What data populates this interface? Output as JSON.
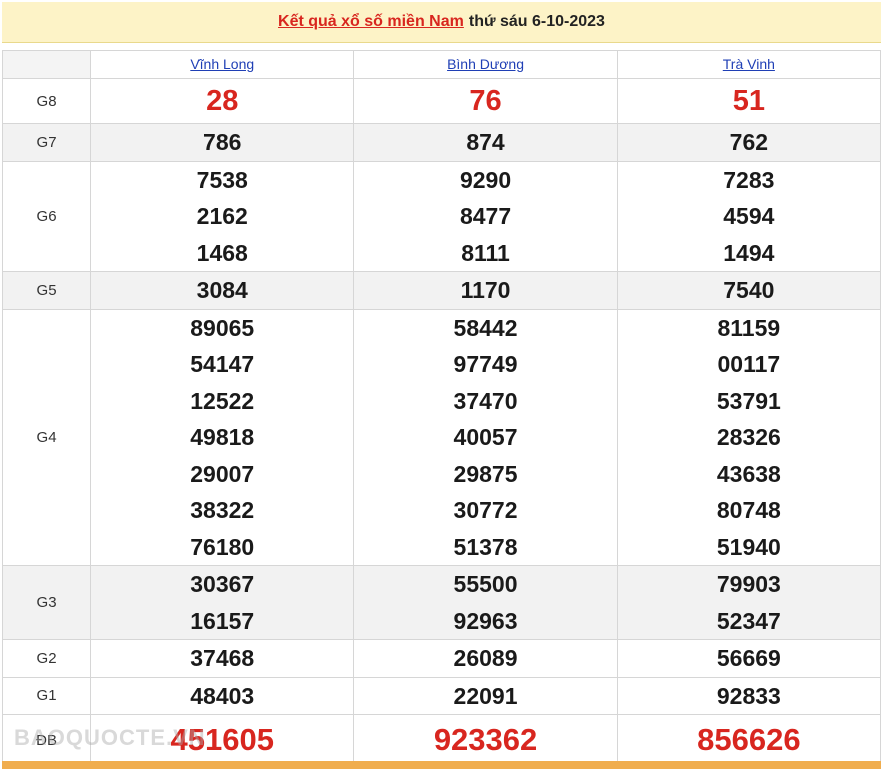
{
  "header": {
    "link_text": "Kết quả xổ số miền Nam",
    "date_text": "thứ sáu 6-10-2023"
  },
  "provinces": [
    "Vĩnh Long",
    "Bình Dương",
    "Trà Vinh"
  ],
  "prizes": [
    {
      "label": "G8",
      "values": [
        [
          "28"
        ],
        [
          "76"
        ],
        [
          "51"
        ]
      ]
    },
    {
      "label": "G7",
      "values": [
        [
          "786"
        ],
        [
          "874"
        ],
        [
          "762"
        ]
      ]
    },
    {
      "label": "G6",
      "values": [
        [
          "7538",
          "2162",
          "1468"
        ],
        [
          "9290",
          "8477",
          "8111"
        ],
        [
          "7283",
          "4594",
          "1494"
        ]
      ]
    },
    {
      "label": "G5",
      "values": [
        [
          "3084"
        ],
        [
          "1170"
        ],
        [
          "7540"
        ]
      ]
    },
    {
      "label": "G4",
      "values": [
        [
          "89065",
          "54147",
          "12522",
          "49818",
          "29007",
          "38322",
          "76180"
        ],
        [
          "58442",
          "97749",
          "37470",
          "40057",
          "29875",
          "30772",
          "51378"
        ],
        [
          "81159",
          "00117",
          "53791",
          "28326",
          "43638",
          "80748",
          "51940"
        ]
      ]
    },
    {
      "label": "G3",
      "values": [
        [
          "30367",
          "16157"
        ],
        [
          "55500",
          "92963"
        ],
        [
          "79903",
          "52347"
        ]
      ]
    },
    {
      "label": "G2",
      "values": [
        [
          "37468"
        ],
        [
          "26089"
        ],
        [
          "56669"
        ]
      ]
    },
    {
      "label": "G1",
      "values": [
        [
          "48403"
        ],
        [
          "22091"
        ],
        [
          "92833"
        ]
      ]
    },
    {
      "label": "ĐB",
      "values": [
        [
          "451605"
        ],
        [
          "923362"
        ],
        [
          "856626"
        ]
      ]
    }
  ],
  "watermark": "BAOQUOCTE.VN",
  "colors": {
    "accent_red": "#d8261f",
    "link_blue": "#1f3fb5",
    "header_bg": "#fdf3c7"
  }
}
